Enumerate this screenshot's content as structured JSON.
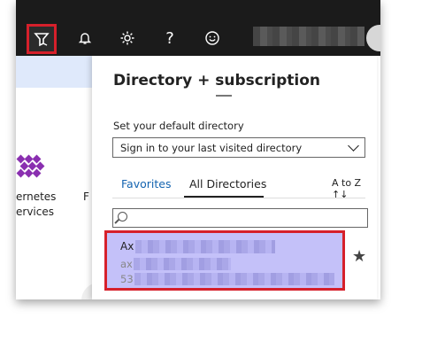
{
  "topbar": {
    "icons": [
      "directory-filter-icon",
      "bell-icon",
      "gear-icon",
      "help-icon",
      "smiley-icon"
    ],
    "help_glyph": "?"
  },
  "left": {
    "line1_a": "ernetes",
    "line1_b": "F",
    "line2": "ervices"
  },
  "panel": {
    "title": "Directory + subscription",
    "default_directory_label": "Set your default directory",
    "dropdown_value": "Sign in to your last visited directory",
    "tabs": [
      "Favorites",
      "All Directories"
    ],
    "active_tab": "All Directories",
    "sort_label": "A to Z ↑↓",
    "search_placeholder": "",
    "directory_item": {
      "name_prefix": "Ax",
      "domain_prefix": "ax",
      "id_prefix": "53"
    },
    "star_glyph": "★"
  },
  "colors": {
    "topbar": "#1b1b1b",
    "highlight_border": "#d6202b",
    "selected_item": "#c4c1f9",
    "link": "#1464b0",
    "scrollbar": "#1e90e8"
  }
}
